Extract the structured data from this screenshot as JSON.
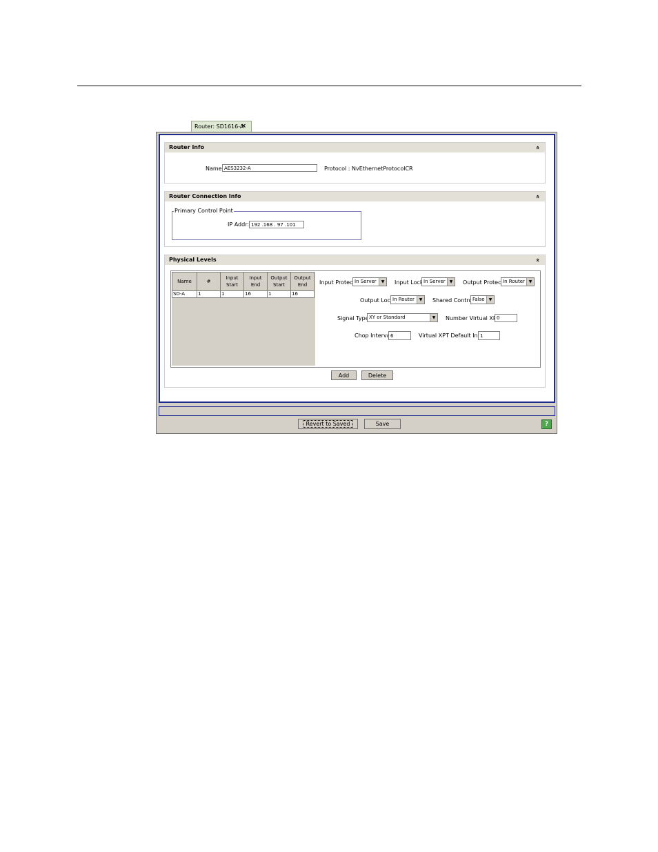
{
  "tab": {
    "title": "Router: SD1616-A",
    "close": "×"
  },
  "router_info": {
    "header": "Router Info",
    "name_label": "Name",
    "name_value": "AES3232-A",
    "protocol_text": "Protocol : NvEthernetProtocolCR"
  },
  "connection_info": {
    "header": "Router Connection Info",
    "group_label": "Primary Control Point",
    "ip_label": "IP Addr:",
    "ip_value": "192 .168 . 97 .101"
  },
  "physical_levels": {
    "header": "Physical Levels",
    "columns": [
      "Name",
      "#",
      "Input Start",
      "Input End",
      "Output Start",
      "Output End"
    ],
    "rows": [
      [
        "SD-A",
        "1",
        "1",
        "16",
        "1",
        "16"
      ]
    ],
    "input_protect_label": "Input Protect",
    "input_protect_value": "In Server",
    "input_lock_label": "Input Lock",
    "input_lock_value": "In Server",
    "output_protect_label": "Output Protect",
    "output_protect_value": "In Router",
    "output_lock_label": "Output Lock",
    "output_lock_value": "In Router",
    "shared_control_label": "Shared Control",
    "shared_control_value": "False",
    "signal_type_label": "Signal Type",
    "signal_type_value": "XY or Standard",
    "num_virtual_label": "Number Virtual XPTs",
    "num_virtual_value": "0",
    "chop_label": "Chop Interval",
    "chop_value": "6",
    "virtual_default_label": "Virtual XPT Default Input",
    "virtual_default_value": "1",
    "add_label": "Add",
    "delete_label": "Delete"
  },
  "footer": {
    "revert_label": "Revert to Saved",
    "save_label": "Save",
    "help_glyph": "?"
  },
  "icons": {
    "collapse": "«",
    "dropdown": "▼"
  },
  "colors": {
    "panel_border": "#1e2a8c",
    "tab_bg": "#dfe9d3",
    "help_bg": "#4fa84f"
  }
}
